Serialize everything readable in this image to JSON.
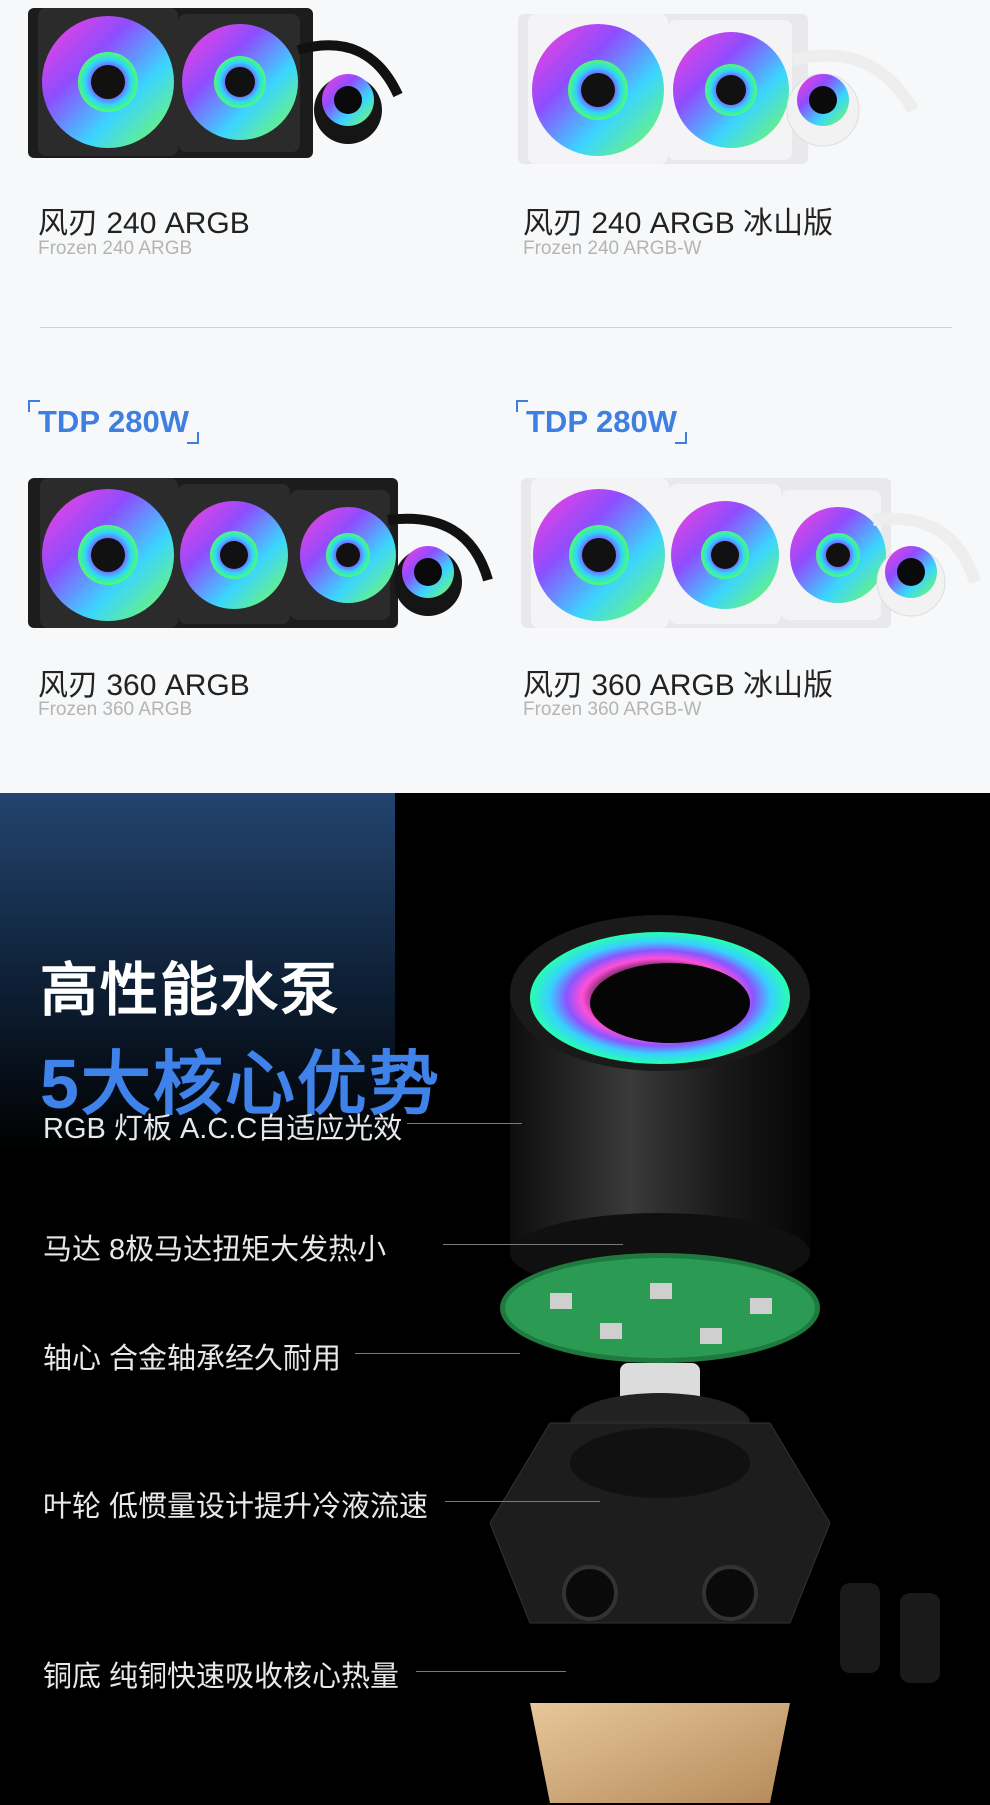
{
  "products": [
    {
      "name": "风刃 240 ARGB",
      "sub": "Frozen 240 ARGB",
      "variant": "black",
      "fans": 2
    },
    {
      "name": "风刃 240 ARGB 冰山版",
      "sub": "Frozen 240 ARGB-W",
      "variant": "white",
      "fans": 2
    },
    {
      "name": "风刃 360 ARGB",
      "sub": "Frozen 360 ARGB",
      "variant": "black",
      "fans": 3
    },
    {
      "name": "风刃 360 ARGB 冰山版",
      "sub": "Frozen 360 ARGB-W",
      "variant": "white",
      "fans": 3
    }
  ],
  "tdp": [
    "TDP 280W",
    "TDP 280W"
  ],
  "pump_section": {
    "title": "高性能水泵",
    "subtitle": "5大核心优势",
    "features": [
      "RGB 灯板 A.C.C自适应光效",
      "马达 8极马达扭矩大发热小",
      "轴心 合金轴承经久耐用",
      "叶轮 低惯量设计提升冷液流速",
      "铜底 纯铜快速吸收核心热量"
    ]
  },
  "colors": {
    "accent": "#3f7fe2",
    "background_top": "#f7f8f9",
    "background_bottom": "#000000"
  }
}
